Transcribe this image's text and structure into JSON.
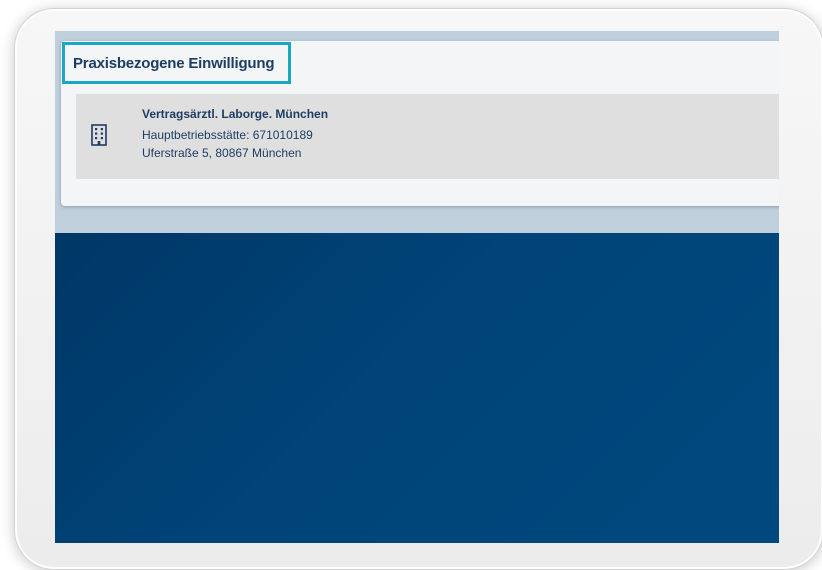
{
  "card": {
    "title": "Praxisbezogene Einwilligung"
  },
  "practice": {
    "icon": "building-icon",
    "name": "Vertragsärztl. Laborge. München",
    "site": "Hauptbetriebsstätte: 671010189",
    "address": "Uferstraße 5, 80867 München"
  },
  "colors": {
    "highlight_border": "#1aa7c4",
    "text_primary": "#1d3d63",
    "background_blue": "#003d70",
    "row_background": "#dfdfdf"
  }
}
